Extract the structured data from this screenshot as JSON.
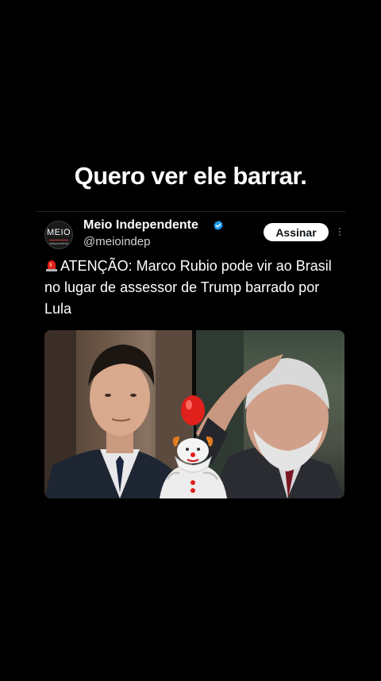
{
  "caption": "Quero ver ele barrar.",
  "tweet": {
    "author_name": "Meio Independente",
    "author_handle": "@meioindep",
    "avatar_logo": "MEIO",
    "avatar_sub": "independente",
    "verified_icon": "verified-badge-icon",
    "follow_label": "Assinar",
    "more_icon": "more-options-icon",
    "alert_icon": "rotating-light-emoji",
    "text": "ATENÇÃO: Marco Rubio pode vir ao Brasil no lugar de assessor de Trump barrado por Lula",
    "media": {
      "left_photo": "man-in-suit-photo",
      "right_photo": "grey-haired-man-hand-on-head-photo",
      "overlay": "clown-with-red-balloon-sticker"
    }
  },
  "colors": {
    "background": "#000000",
    "verified": "#1d9bf0",
    "follow_bg": "#ffffff",
    "balloon": "#e0201b"
  }
}
